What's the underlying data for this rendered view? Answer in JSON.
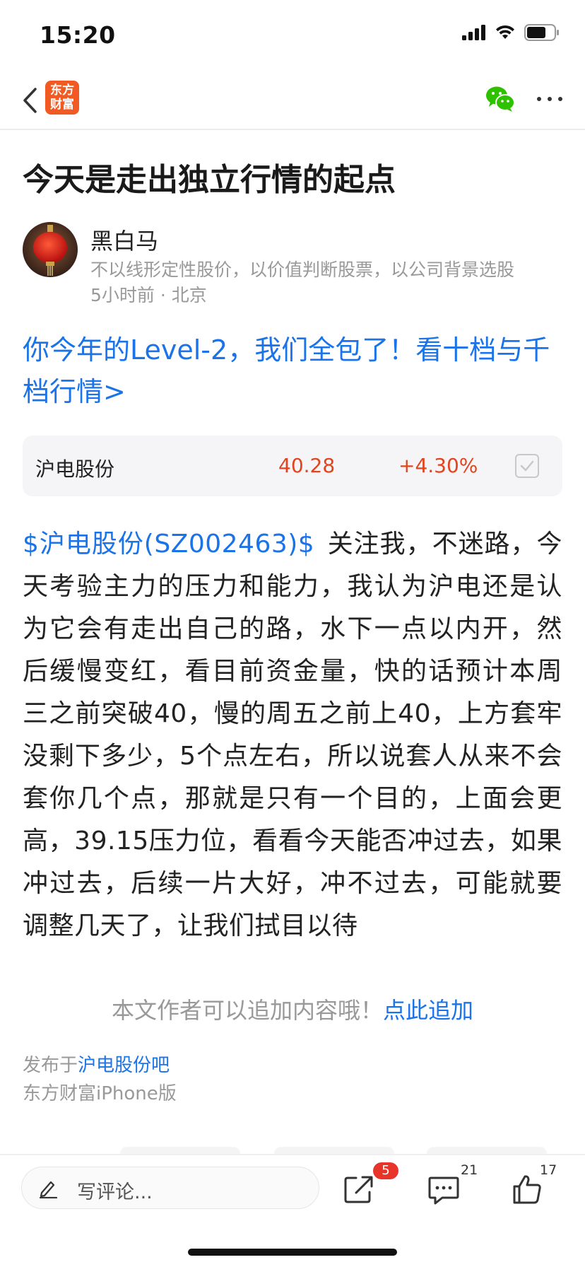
{
  "status_bar": {
    "time": "15:20"
  },
  "nav": {
    "logo_line1": "东方",
    "logo_line2": "财富"
  },
  "article": {
    "title": "今天是走出独立行情的起点",
    "author": {
      "name": "黑白马",
      "bio": "不以线形定性股价，以价值判断股票，以公司背景选股",
      "meta": "5小时前 · 北京"
    },
    "promo_link": "你今年的Level-2，我们全包了！看十档与千档行情>",
    "stock_card": {
      "name": "沪电股份",
      "price": "40.28",
      "change": "+4.30%",
      "change_color": "#e0451f"
    },
    "stock_tag": "$沪电股份(SZ002463)$",
    "body": "关注我，不迷路，今天考验主力的压力和能力，我认为沪电还是认为它会有走出自己的路，水下一点以内开，然后缓慢变红，看目前资金量，快的话预计本周三之前突破40，慢的周五之前上40，上方套牢没剩下多少，5个点左右，所以说套人从来不会套你几个点，那就是只有一个目的，上面会更高，39.15压力位，看看今天能否冲过去，如果冲过去，后续一片大好，冲不过去，可能就要调整几天了，让我们拭目以待",
    "append_hint": "本文作者可以追加内容哦！",
    "append_link": "点此追加",
    "published_prefix": "发布于",
    "published_bar": "沪电股份吧",
    "client": "东方财富iPhone版"
  },
  "bottom_bar": {
    "comment_placeholder": "写评论...",
    "share_badge": "5",
    "comments_count": "21",
    "likes_count": "17"
  },
  "colors": {
    "accent_blue": "#1a73e8",
    "brand_orange": "#f15a22",
    "up_red": "#e0451f"
  },
  "icons": [
    "back-icon",
    "app-logo",
    "wechat-icon",
    "more-icon",
    "checkbox-icon",
    "pencil-icon",
    "share-icon",
    "comment-icon",
    "like-icon"
  ]
}
